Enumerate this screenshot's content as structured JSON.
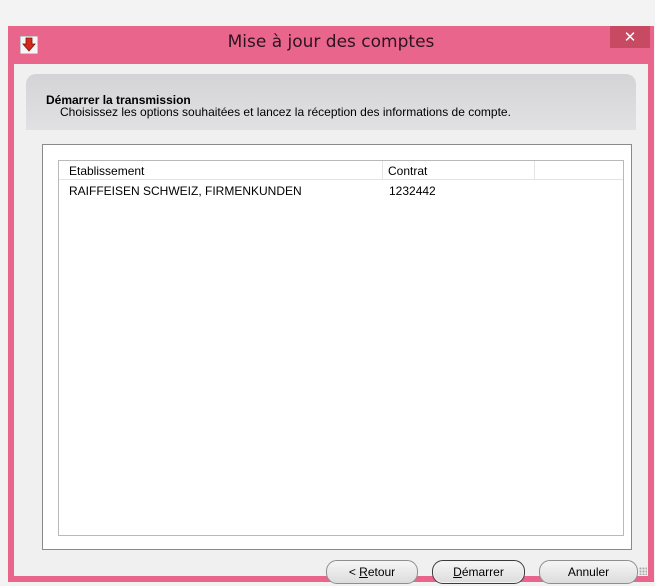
{
  "window": {
    "title": "Mise à jour des comptes",
    "close_glyph": "✕",
    "accent_color": "#e9658c",
    "app_icon": "app-arrow-down-icon"
  },
  "header": {
    "title": "Démarrer la transmission",
    "subtitle": "Choisissez les options souhaitées et lancez la réception des informations de compte."
  },
  "table": {
    "columns": [
      "Etablissement",
      "Contrat"
    ],
    "rows": [
      [
        "RAIFFEISEN SCHWEIZ, FIRMENKUNDEN",
        "1232442"
      ]
    ]
  },
  "buttons": {
    "back": {
      "prefix": "< ",
      "mnemonic": "R",
      "rest": "etour"
    },
    "start": {
      "prefix": "",
      "mnemonic": "D",
      "rest": "émarrer"
    },
    "cancel": "Annuler"
  }
}
